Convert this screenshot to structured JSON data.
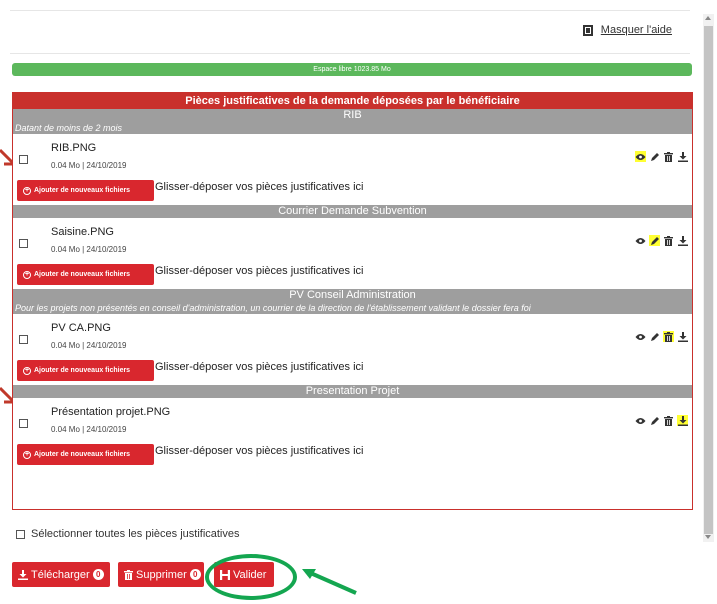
{
  "top_partial_text": ". . . . .",
  "help": {
    "label": "Masquer l'aide"
  },
  "space": {
    "label": "Espace libre 1023.85 Mo"
  },
  "panel": {
    "title": "Pièces justificatives de la demande déposées par le bénéficiaire",
    "sections": [
      {
        "title": "RIB",
        "subtitle": "Datant de moins de 2 mois",
        "file": {
          "name": "RIB.PNG",
          "meta": "0.04 Mo | 24/10/2019"
        },
        "highlighted_action": "view"
      },
      {
        "title": "Courrier Demande Subvention",
        "subtitle": "",
        "file": {
          "name": "Saisine.PNG",
          "meta": "0.04 Mo | 24/10/2019"
        },
        "highlighted_action": "edit"
      },
      {
        "title": "PV Conseil Administration",
        "subtitle": "Pour les projets non présentés en conseil d'administration, un courrier de la direction de l'établissement validant le dossier fera foi",
        "file": {
          "name": "PV CA.PNG",
          "meta": "0.04 Mo | 24/10/2019"
        },
        "highlighted_action": "delete"
      },
      {
        "title": "Presentation Projet",
        "subtitle": "",
        "file": {
          "name": "Présentation projet.PNG",
          "meta": "0.04 Mo | 24/10/2019"
        },
        "highlighted_action": "download"
      }
    ],
    "add_button_label": "Ajouter de nouveaux fichiers",
    "drop_text": "Glisser-déposer vos pièces justificatives ici"
  },
  "select_all_label": "Sélectionner toutes les pièces justificatives",
  "buttons": {
    "download": {
      "label": "Télécharger",
      "count": "0"
    },
    "delete": {
      "label": "Supprimer",
      "count": "0"
    },
    "validate": {
      "label": "Valider"
    }
  },
  "colors": {
    "accent_red": "#d9272e",
    "success_green": "#5cb85c",
    "section_grey": "#9e9e9e",
    "highlight_yellow": "#ffff33",
    "annotation_green": "#14a650",
    "annotation_arrow_red": "#c0392b"
  }
}
